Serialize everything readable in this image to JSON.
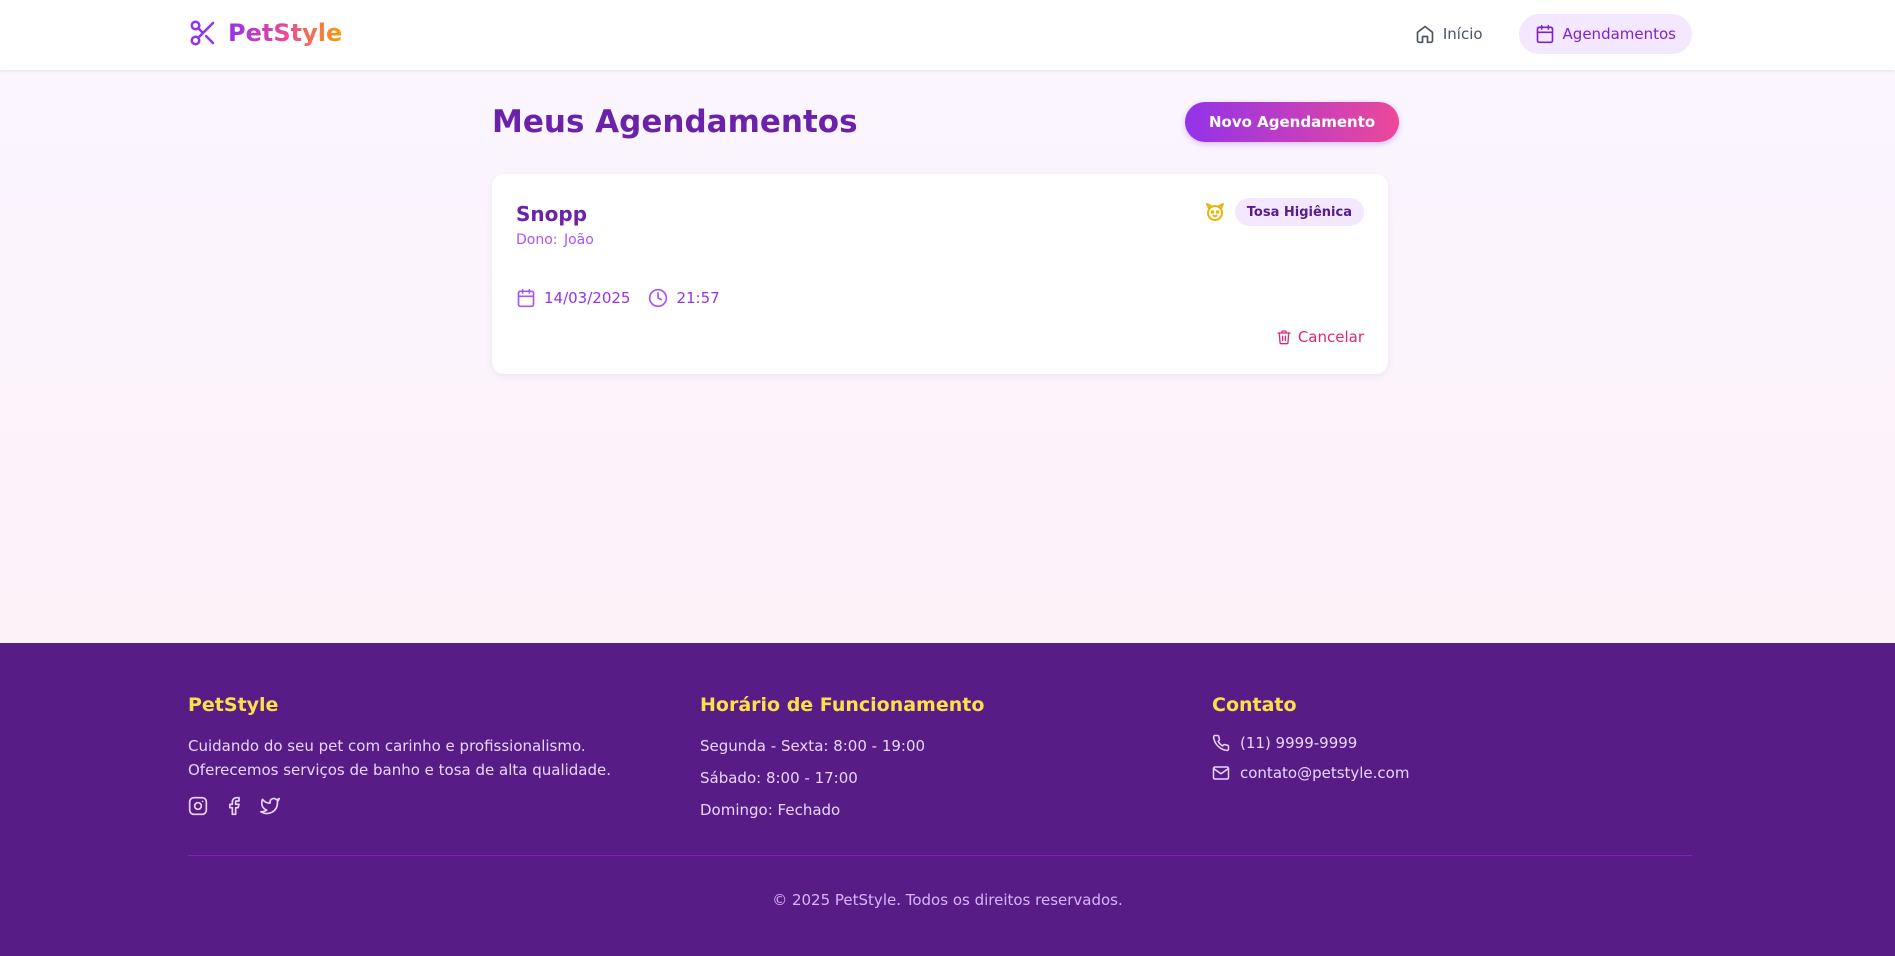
{
  "header": {
    "logo_text": "PetStyle",
    "nav": [
      {
        "label": "Início",
        "icon": "home-icon",
        "active": false
      },
      {
        "label": "Agendamentos",
        "icon": "calendar-icon",
        "active": true
      }
    ]
  },
  "main": {
    "title": "Meus Agendamentos",
    "new_button_label": "Novo Agendamento",
    "appointments": [
      {
        "pet_name": "Snopp",
        "owner_label": "Dono:",
        "owner_name": "João",
        "service": "Tosa Higiênica",
        "service_icon": "dog-face-icon",
        "date": "14/03/2025",
        "time": "21:57",
        "cancel_label": "Cancelar"
      }
    ]
  },
  "footer": {
    "brand": {
      "title": "PetStyle",
      "description": "Cuidando do seu pet com carinho e profissionalismo. Oferecemos serviços de banho e tosa de alta qualidade.",
      "social_icons": [
        "instagram-icon",
        "facebook-icon",
        "twitter-icon"
      ]
    },
    "hours": {
      "title": "Horário de Funcionamento",
      "lines": [
        "Segunda - Sexta: 8:00 - 19:00",
        "Sábado: 8:00 - 17:00",
        "Domingo: Fechado"
      ]
    },
    "contact": {
      "title": "Contato",
      "phone": "(11) 9999-9999",
      "email": "contato@petstyle.com"
    },
    "copyright": "© 2025 PetStyle. Todos os direitos reservados."
  },
  "colors": {
    "primary_purple": "#6b21a8",
    "accent_pink": "#ec4899",
    "footer_bg": "#581c87",
    "footer_heading": "#fde047"
  }
}
